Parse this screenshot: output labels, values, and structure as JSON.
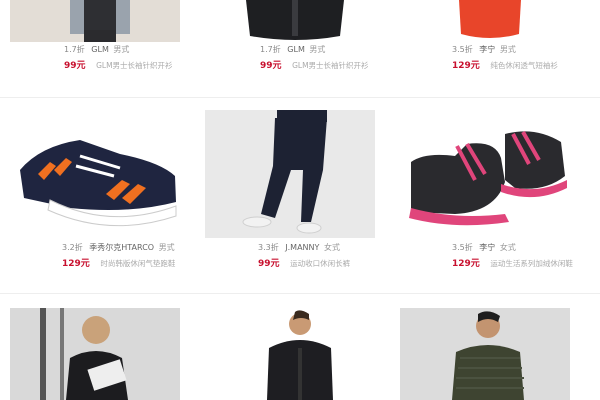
{
  "products": [
    {
      "sales": "1.7折",
      "brand": "GLM",
      "gender": "男式",
      "price": "99元",
      "desc": "GLM男士长袖针织开衫"
    },
    {
      "sales": "1.7折",
      "brand": "GLM",
      "gender": "男式",
      "price": "99元",
      "desc": "GLM男士长袖针织开衫"
    },
    {
      "sales": "3.5折",
      "brand": "李宁",
      "gender": "男式",
      "price": "129元",
      "desc": "纯色休闲透气短袖衫"
    },
    {
      "sales": "3.2折",
      "brand": "季秀尔克HTARCO",
      "gender": "男式",
      "price": "129元",
      "desc": "时尚韩版休闲气垫跑鞋"
    },
    {
      "sales": "3.3折",
      "brand": "J.MANNY",
      "gender": "女式",
      "price": "99元",
      "desc": "运动收口休闲长裤"
    },
    {
      "sales": "3.5折",
      "brand": "李宁",
      "gender": "女式",
      "price": "129元",
      "desc": "运动生活系列加绒休闲鞋"
    }
  ],
  "colors": {
    "price": "#c8102e",
    "accent_pink": "#e0457b",
    "accent_orange": "#f07020"
  }
}
